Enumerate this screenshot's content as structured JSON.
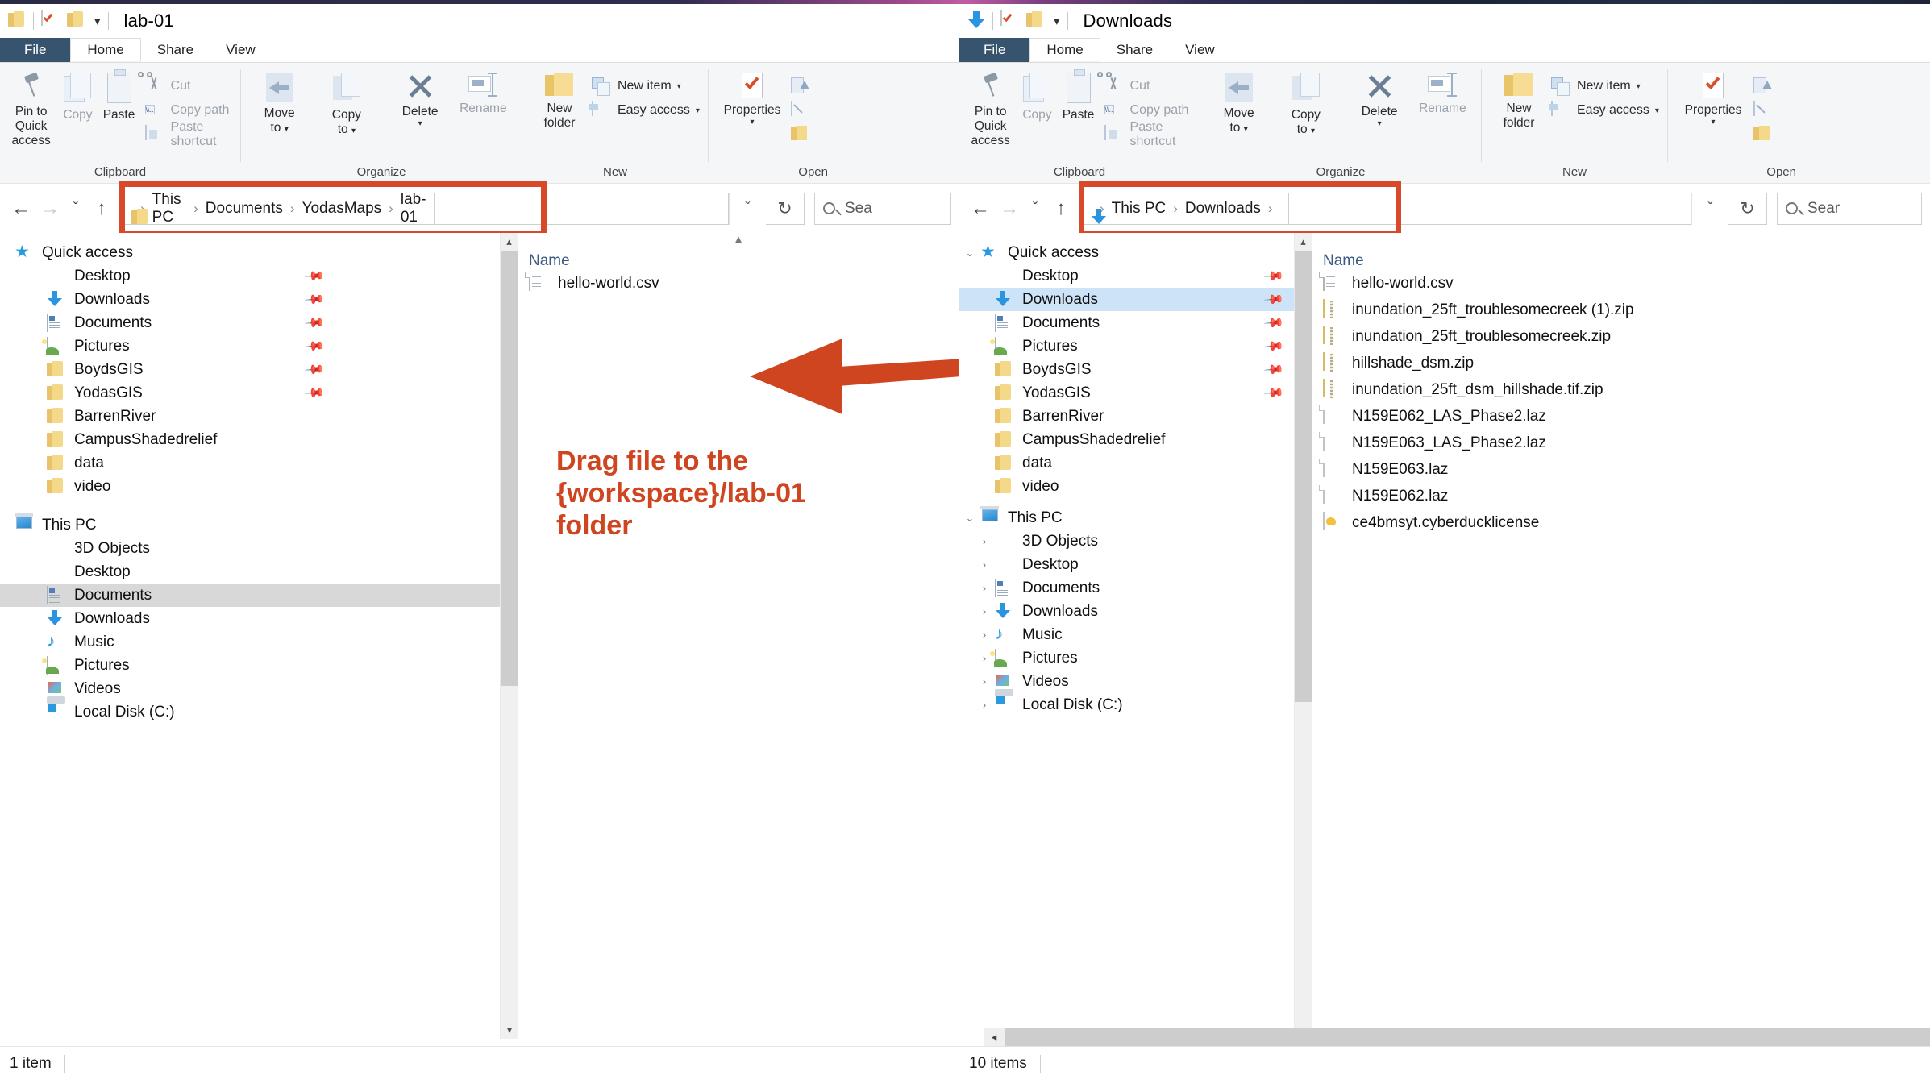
{
  "left_window": {
    "titlebar": {
      "title": "lab-01",
      "icons": [
        "folder-icon",
        "properties-check-icon",
        "folder-small-icon",
        "quick-access-toolbar-dropdown-icon"
      ]
    },
    "tabs": [
      {
        "id": "file",
        "label": "File"
      },
      {
        "id": "home",
        "label": "Home"
      },
      {
        "id": "share",
        "label": "Share"
      },
      {
        "id": "view",
        "label": "View"
      }
    ],
    "ribbon": {
      "groups": [
        {
          "label": "Clipboard",
          "big": [
            {
              "name": "pin-to-quick-access",
              "label": "Pin to Quick\naccess",
              "line1": "Pin to Quick",
              "line2": "access",
              "icon": "pin-icon"
            },
            {
              "name": "copy",
              "label": "Copy",
              "icon": "copy-icon",
              "dim": true
            },
            {
              "name": "paste",
              "label": "Paste",
              "icon": "paste-icon"
            }
          ],
          "small": [
            {
              "name": "cut",
              "label": "Cut",
              "icon": "scissors-icon"
            },
            {
              "name": "copy-path",
              "label": "Copy path",
              "icon": "copy-path-icon"
            },
            {
              "name": "paste-shortcut",
              "label": "Paste shortcut",
              "icon": "paste-shortcut-icon"
            }
          ]
        },
        {
          "label": "Organize",
          "big": [
            {
              "name": "move-to",
              "line1": "Move",
              "line2": "to",
              "caret": "▾",
              "icon": "move-to-icon"
            },
            {
              "name": "copy-to",
              "line1": "Copy",
              "line2": "to",
              "caret": "▾",
              "icon": "copy-to-icon"
            },
            {
              "name": "delete",
              "line1": "Delete",
              "line2": "",
              "caret": "▾",
              "icon": "delete-x-icon"
            },
            {
              "name": "rename",
              "line1": "Rename",
              "line2": "",
              "icon": "rename-icon"
            }
          ],
          "small": []
        },
        {
          "label": "New",
          "big": [
            {
              "name": "new-folder",
              "line1": "New",
              "line2": "folder",
              "icon": "new-folder-icon"
            }
          ],
          "small": [
            {
              "name": "new-item",
              "label": "New item",
              "icon": "new-item-icon",
              "caret": "▾"
            },
            {
              "name": "easy-access",
              "label": "Easy access",
              "icon": "easy-access-icon",
              "caret": "▾"
            }
          ]
        },
        {
          "label": "Open",
          "big": [
            {
              "name": "properties",
              "line1": "Properties",
              "line2": "",
              "caret": "▾",
              "icon": "properties-icon"
            }
          ],
          "small": [
            {
              "name": "open-with",
              "label": "",
              "icon": "open-with-icon"
            },
            {
              "name": "edit",
              "label": "",
              "icon": "edit-icon"
            },
            {
              "name": "history",
              "label": "",
              "icon": "history-icon"
            }
          ]
        }
      ]
    },
    "address": {
      "crumbs": [
        "This PC",
        "Documents",
        "YodasMaps",
        "lab-01"
      ],
      "separator": "›",
      "leading_icon": "folder-icon",
      "highlighted": true,
      "dropdown_icon": "ˇ",
      "refresh_icon": "↻"
    },
    "search": {
      "placeholder": "Sea"
    },
    "nav_back_icon": "←",
    "nav_forward_icon": "→",
    "nav_recent_icon": "ˇ",
    "nav_up_icon": "↑",
    "nav_tree": {
      "quick_access": {
        "label": "Quick access",
        "icon": "star-icon",
        "items": [
          {
            "label": "Desktop",
            "icon": "desktop-icon",
            "pinned": true
          },
          {
            "label": "Downloads",
            "icon": "downloads-icon",
            "pinned": true
          },
          {
            "label": "Documents",
            "icon": "documents-icon",
            "pinned": true
          },
          {
            "label": "Pictures",
            "icon": "pictures-icon",
            "pinned": true
          },
          {
            "label": "BoydsGIS",
            "icon": "folder-icon",
            "pinned": true
          },
          {
            "label": "YodasGIS",
            "icon": "folder-icon",
            "pinned": true
          },
          {
            "label": "BarrenRiver",
            "icon": "folder-icon",
            "pinned": false
          },
          {
            "label": "CampusShadedrelief",
            "icon": "folder-icon",
            "pinned": false
          },
          {
            "label": "data",
            "icon": "folder-icon",
            "pinned": false
          },
          {
            "label": "video",
            "icon": "folder-icon",
            "pinned": false
          }
        ]
      },
      "this_pc": {
        "label": "This PC",
        "icon": "this-pc-icon",
        "items": [
          {
            "label": "3D Objects",
            "icon": "3d-objects-icon"
          },
          {
            "label": "Desktop",
            "icon": "desktop-icon"
          },
          {
            "label": "Documents",
            "icon": "documents-icon",
            "selected": true
          },
          {
            "label": "Downloads",
            "icon": "downloads-icon"
          },
          {
            "label": "Music",
            "icon": "music-icon"
          },
          {
            "label": "Pictures",
            "icon": "pictures-icon"
          },
          {
            "label": "Videos",
            "icon": "videos-icon"
          },
          {
            "label": "Local Disk (C:)",
            "icon": "local-disk-icon"
          }
        ]
      }
    },
    "file_list": {
      "column_header": "Name",
      "rows": [
        {
          "name": "hello-world.csv",
          "icon": "csv-file-icon"
        }
      ]
    },
    "status": {
      "text": "1 item"
    }
  },
  "right_window": {
    "titlebar": {
      "title": "Downloads",
      "icons": [
        "downloads-icon",
        "properties-check-icon",
        "folder-small-icon",
        "quick-access-toolbar-dropdown-icon"
      ]
    },
    "tabs": [
      {
        "id": "file",
        "label": "File"
      },
      {
        "id": "home",
        "label": "Home"
      },
      {
        "id": "share",
        "label": "Share"
      },
      {
        "id": "view",
        "label": "View"
      }
    ],
    "ribbon": {
      "groups": [
        {
          "label": "Clipboard",
          "big": [
            {
              "name": "pin-to-quick-access",
              "line1": "Pin to Quick",
              "line2": "access",
              "icon": "pin-icon"
            },
            {
              "name": "copy",
              "line1": "Copy",
              "line2": "",
              "icon": "copy-icon",
              "dim": true
            },
            {
              "name": "paste",
              "line1": "Paste",
              "line2": "",
              "icon": "paste-icon"
            }
          ],
          "small": [
            {
              "name": "cut",
              "label": "Cut",
              "icon": "scissors-icon"
            },
            {
              "name": "copy-path",
              "label": "Copy path",
              "icon": "copy-path-icon"
            },
            {
              "name": "paste-shortcut",
              "label": "Paste shortcut",
              "icon": "paste-shortcut-icon"
            }
          ]
        },
        {
          "label": "Organize",
          "big": [
            {
              "name": "move-to",
              "line1": "Move",
              "line2": "to",
              "caret": "▾",
              "icon": "move-to-icon"
            },
            {
              "name": "copy-to",
              "line1": "Copy",
              "line2": "to",
              "caret": "▾",
              "icon": "copy-to-icon"
            },
            {
              "name": "delete",
              "line1": "Delete",
              "line2": "",
              "caret": "▾",
              "icon": "delete-x-icon"
            },
            {
              "name": "rename",
              "line1": "Rename",
              "line2": "",
              "icon": "rename-icon"
            }
          ],
          "small": []
        },
        {
          "label": "New",
          "big": [
            {
              "name": "new-folder",
              "line1": "New",
              "line2": "folder",
              "icon": "new-folder-icon"
            }
          ],
          "small": [
            {
              "name": "new-item",
              "label": "New item",
              "icon": "new-item-icon",
              "caret": "▾"
            },
            {
              "name": "easy-access",
              "label": "Easy access",
              "icon": "easy-access-icon",
              "caret": "▾"
            }
          ]
        },
        {
          "label": "Open",
          "big": [
            {
              "name": "properties",
              "line1": "Properties",
              "line2": "",
              "caret": "▾",
              "icon": "properties-icon"
            }
          ],
          "small": [
            {
              "name": "open-with",
              "label": "",
              "icon": "open-with-icon"
            },
            {
              "name": "edit",
              "label": "",
              "icon": "edit-icon"
            },
            {
              "name": "history",
              "label": "",
              "icon": "history-icon"
            }
          ]
        }
      ]
    },
    "address": {
      "crumbs": [
        "This PC",
        "Downloads"
      ],
      "separator": "›",
      "trailing_separator": "›",
      "leading_icon": "downloads-icon",
      "highlighted": true,
      "dropdown_icon": "ˇ",
      "refresh_icon": "↻"
    },
    "search": {
      "placeholder": "Sear"
    },
    "nav_back_icon": "←",
    "nav_forward_icon": "→",
    "nav_recent_icon": "ˇ",
    "nav_up_icon": "↑",
    "nav_tree": {
      "quick_access": {
        "label": "Quick access",
        "icon": "star-icon",
        "expander": "⌄",
        "items": [
          {
            "label": "Desktop",
            "icon": "desktop-icon",
            "pinned": true
          },
          {
            "label": "Downloads",
            "icon": "downloads-icon",
            "pinned": true,
            "selected": true
          },
          {
            "label": "Documents",
            "icon": "documents-icon",
            "pinned": true
          },
          {
            "label": "Pictures",
            "icon": "pictures-icon",
            "pinned": true
          },
          {
            "label": "BoydsGIS",
            "icon": "folder-icon",
            "pinned": true
          },
          {
            "label": "YodasGIS",
            "icon": "folder-icon",
            "pinned": true
          },
          {
            "label": "BarrenRiver",
            "icon": "folder-icon",
            "pinned": false
          },
          {
            "label": "CampusShadedrelief",
            "icon": "folder-icon",
            "pinned": false
          },
          {
            "label": "data",
            "icon": "folder-icon",
            "pinned": false
          },
          {
            "label": "video",
            "icon": "folder-icon",
            "pinned": false
          }
        ]
      },
      "this_pc": {
        "label": "This PC",
        "icon": "this-pc-icon",
        "expander": "⌄",
        "items": [
          {
            "label": "3D Objects",
            "icon": "3d-objects-icon",
            "chevron": "›"
          },
          {
            "label": "Desktop",
            "icon": "desktop-icon",
            "chevron": "›"
          },
          {
            "label": "Documents",
            "icon": "documents-icon",
            "chevron": "›"
          },
          {
            "label": "Downloads",
            "icon": "downloads-icon",
            "chevron": "›"
          },
          {
            "label": "Music",
            "icon": "music-icon",
            "chevron": "›"
          },
          {
            "label": "Pictures",
            "icon": "pictures-icon",
            "chevron": "›"
          },
          {
            "label": "Videos",
            "icon": "videos-icon",
            "chevron": "›"
          },
          {
            "label": "Local Disk (C:)",
            "icon": "local-disk-icon",
            "chevron": "›"
          }
        ]
      }
    },
    "file_list": {
      "column_header": "Name",
      "rows": [
        {
          "name": "hello-world.csv",
          "icon": "csv-file-icon"
        },
        {
          "name": "inundation_25ft_troublesomecreek (1).zip",
          "icon": "zip-file-icon"
        },
        {
          "name": "inundation_25ft_troublesomecreek.zip",
          "icon": "zip-file-icon"
        },
        {
          "name": "hillshade_dsm.zip",
          "icon": "zip-file-icon"
        },
        {
          "name": "inundation_25ft_dsm_hillshade.tif.zip",
          "icon": "zip-file-icon"
        },
        {
          "name": "N159E062_LAS_Phase2.laz",
          "icon": "blank-file-icon"
        },
        {
          "name": "N159E063_LAS_Phase2.laz",
          "icon": "blank-file-icon"
        },
        {
          "name": "N159E063.laz",
          "icon": "blank-file-icon"
        },
        {
          "name": "N159E062.laz",
          "icon": "blank-file-icon"
        },
        {
          "name": "ce4bmsyt.cyberducklicense",
          "icon": "cyberduck-file-icon"
        }
      ]
    },
    "status": {
      "text": "10 items"
    }
  },
  "annotation": {
    "line1": "Drag file to the",
    "line2": "{workspace}/lab-01",
    "line3": "folder",
    "color": "#cf4520",
    "arrow": "drag-direction-arrow"
  }
}
